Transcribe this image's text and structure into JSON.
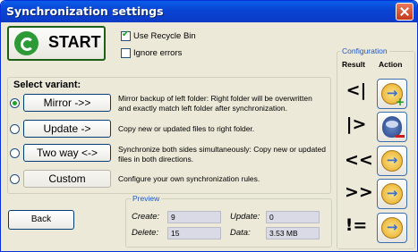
{
  "window": {
    "title": "Synchronization settings"
  },
  "start": {
    "label": "START"
  },
  "options": {
    "use_recycle_bin": {
      "label": "Use Recycle Bin",
      "checked": true
    },
    "ignore_errors": {
      "label": "Ignore errors",
      "checked": false
    }
  },
  "variants": {
    "title": "Select variant:",
    "items": [
      {
        "label": "Mirror ->>",
        "selected": true,
        "description": "Mirror backup of left folder: Right folder will be overwritten and exactly match left folder after synchronization."
      },
      {
        "label": "Update ->",
        "selected": false,
        "description": "Copy new or updated files to right folder."
      },
      {
        "label": "Two way <->",
        "selected": false,
        "description": "Synchronize both sides simultaneously: Copy new or updated files in both directions."
      },
      {
        "label": "Custom",
        "selected": false,
        "description": "Configure your own synchronization rules."
      }
    ]
  },
  "back": {
    "label": "Back"
  },
  "preview": {
    "title": "Preview",
    "create_label": "Create:",
    "create_value": "9",
    "update_label": "Update:",
    "update_value": "0",
    "delete_label": "Delete:",
    "delete_value": "15",
    "data_label": "Data:",
    "data_value": "3.53 MB"
  },
  "configuration": {
    "title": "Configuration",
    "result_header": "Result",
    "action_header": "Action",
    "rows": [
      {
        "result": "<|",
        "action_icon": "copy-right-add-icon"
      },
      {
        "result": "|>",
        "action_icon": "delete-icon"
      },
      {
        "result": "<<",
        "action_icon": "copy-right-icon"
      },
      {
        "result": ">>",
        "action_icon": "copy-right-icon"
      },
      {
        "result": "!=",
        "action_icon": "copy-right-icon"
      }
    ]
  }
}
